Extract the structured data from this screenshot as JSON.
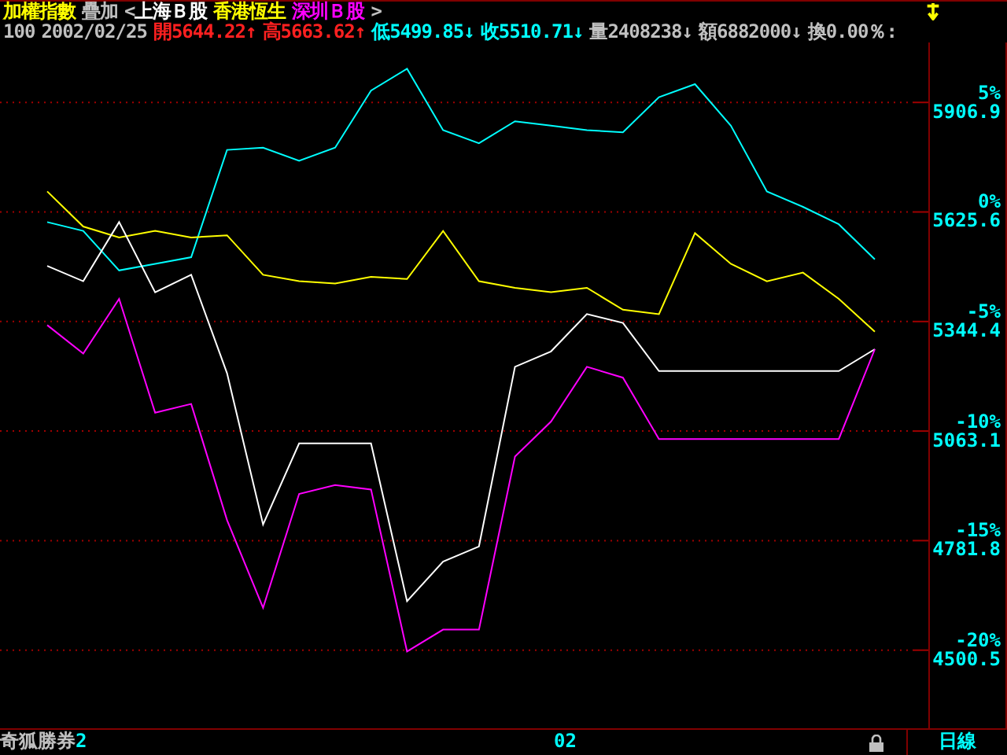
{
  "header": {
    "title": "加權指數",
    "overlay_label": "疊加",
    "overlay_open": "<",
    "overlays": [
      {
        "name": "上海Ｂ股",
        "color": "#ffffff"
      },
      {
        "name": "香港恆生",
        "color": "#ffff00"
      },
      {
        "name": "深圳Ｂ股",
        "color": "#ff00ff"
      }
    ],
    "overlay_close": ">",
    "period": "100",
    "date": "2002/02/25",
    "quotes": [
      {
        "text": "開5644.22",
        "arrow": "↑",
        "color": "#ff2020"
      },
      {
        "text": "高5663.62",
        "arrow": "↑",
        "color": "#ff2020"
      },
      {
        "text": "低5499.85",
        "arrow": "↓",
        "color": "#00ffff"
      },
      {
        "text": "收5510.71",
        "arrow": "↓",
        "color": "#00ffff"
      },
      {
        "text": "量2408238",
        "arrow": "↓",
        "color": "#c0c0c0"
      },
      {
        "text": "額6882000",
        "arrow": "↓",
        "color": "#c0c0c0"
      },
      {
        "text": "換0.00％",
        "arrow": ":",
        "color": "#c0c0c0"
      }
    ]
  },
  "chart": {
    "chart_data": {
      "type": "line",
      "grid": true,
      "ylim": [
        -23.6,
        7.7
      ],
      "yticks": [
        {
          "value": 5,
          "label": "5%"
        },
        {
          "value": 0,
          "label": "0%"
        },
        {
          "value": -5,
          "label": "-5%"
        },
        {
          "value": -10,
          "label": "-10%"
        },
        {
          "value": -15,
          "label": "-15%"
        },
        {
          "value": -20,
          "label": "-20%"
        }
      ],
      "series": [
        {
          "color": "#00ffff",
          "values": [
            -0.5,
            -0.9,
            -2.7,
            -2.4,
            -2.1,
            2.8,
            2.9,
            2.3,
            2.9,
            5.5,
            6.5,
            3.7,
            3.1,
            4.1,
            3.9,
            3.7,
            3.6,
            5.2,
            5.8,
            3.9,
            0.9,
            0.2,
            -0.6,
            -2.2
          ]
        },
        {
          "color": "#ffff00",
          "values": [
            0.9,
            -0.7,
            -1.2,
            -0.9,
            -1.2,
            -1.1,
            -2.9,
            -3.2,
            -3.3,
            -3.0,
            -3.1,
            -0.9,
            -3.2,
            -3.5,
            -3.7,
            -3.5,
            -4.5,
            -4.7,
            -1.0,
            -2.4,
            -3.2,
            -2.8,
            -4.0,
            -5.5
          ]
        },
        {
          "color": "#ffffff",
          "values": [
            -2.5,
            -3.2,
            -0.5,
            -3.7,
            -2.9,
            -7.4,
            -14.3,
            -10.6,
            -10.6,
            -10.6,
            -17.8,
            -16.0,
            -15.3,
            -7.1,
            -6.4,
            -4.7,
            -5.1,
            -7.3,
            -7.3,
            -7.3,
            -7.3,
            -7.3,
            -7.3,
            -6.3
          ]
        },
        {
          "color": "#ff00ff",
          "values": [
            -5.2,
            -6.5,
            -4.0,
            -9.2,
            -8.8,
            -14.1,
            -18.1,
            -12.9,
            -12.5,
            -12.7,
            -20.1,
            -19.1,
            -19.1,
            -11.2,
            -9.6,
            -7.1,
            -7.6,
            -10.4,
            -10.4,
            -10.4,
            -10.4,
            -10.4,
            -10.4,
            -6.3
          ]
        }
      ]
    },
    "price_labels": [
      "5906.9",
      "5625.6",
      "5344.4",
      "5063.1",
      "4781.8",
      "4500.5"
    ]
  },
  "footer": {
    "brand": "奇狐勝券",
    "brand_suffix": "2",
    "month_label": "02",
    "period_label": "日線"
  }
}
